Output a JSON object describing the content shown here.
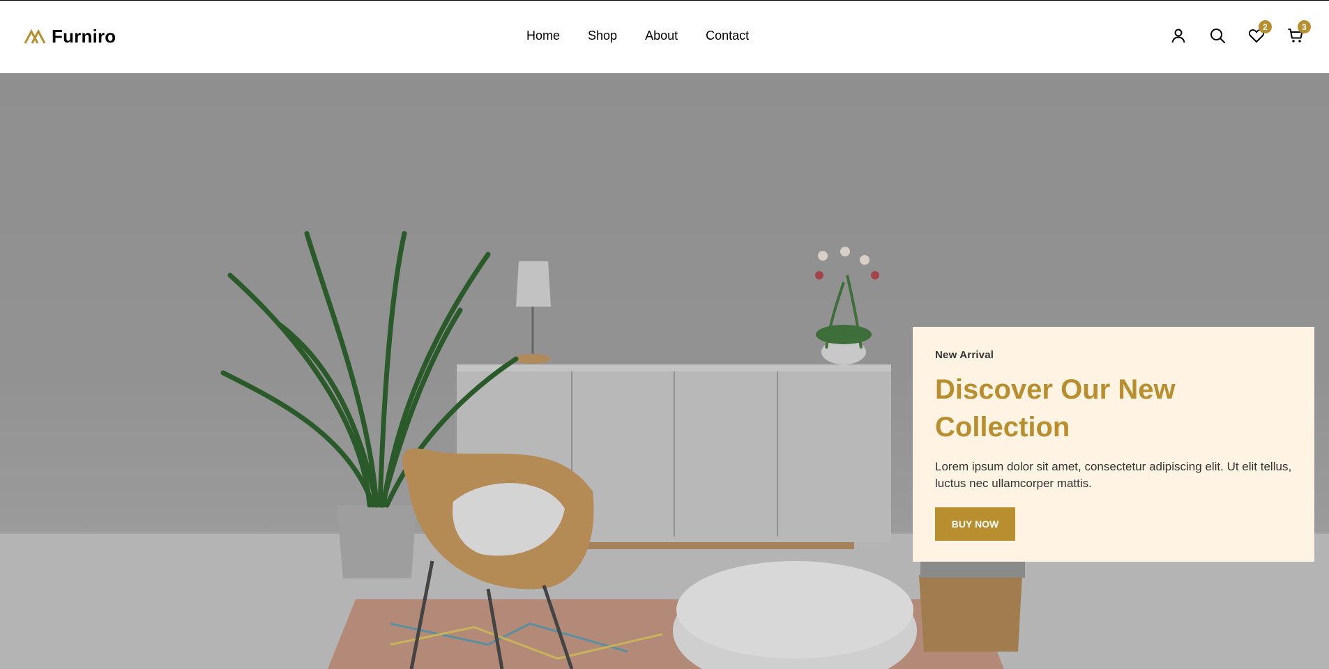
{
  "brand": {
    "name": "Furniro",
    "accent": "#B88E2F"
  },
  "nav": {
    "items": [
      "Home",
      "Shop",
      "About",
      "Contact"
    ]
  },
  "header_actions": {
    "account_icon": "user-icon",
    "search_icon": "search-icon",
    "wishlist_icon": "heart-icon",
    "wishlist_count": "2",
    "cart_icon": "cart-icon",
    "cart_count": "3"
  },
  "hero": {
    "eyebrow": "New Arrival",
    "headline": "Discover Our New Collection",
    "description": "Lorem ipsum dolor sit amet, consectetur adipiscing elit. Ut elit tellus, luctus nec ullamcorper mattis.",
    "cta_label": "BUY NOW",
    "card_bg": "#FFF3E3"
  }
}
